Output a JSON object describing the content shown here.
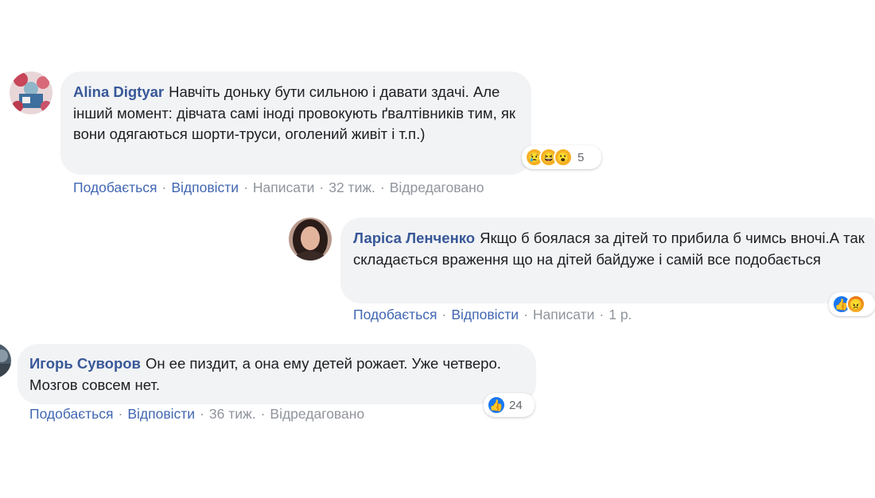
{
  "comments": [
    {
      "author": "Alina Digtyar",
      "text": "Навчіть доньку бути сильною і давати здачі. Але інший момент: дівчата самі іноді провокують ґвалтівників тим, як вони одягаються шорти-труси, оголений живіт і т.п.)",
      "reaction_count": "5",
      "reaction_icons": [
        "sad-icon",
        "haha-icon",
        "wow-icon"
      ],
      "actions": {
        "like": "Подобається",
        "reply": "Відповісти",
        "message": "Написати",
        "time": "32 тиж.",
        "edited": "Відредаговано"
      }
    },
    {
      "author": "Ларіса Ленченко",
      "text": "Якщо б боялася за дітей то прибила б чимсь вночі.А так складається враження що на дітей байдуже і самій все подобається",
      "reaction_icons": [
        "like-icon",
        "angry-icon"
      ],
      "actions": {
        "like": "Подобається",
        "reply": "Відповісти",
        "message": "Написати",
        "time": "1 р."
      }
    },
    {
      "author": "Игорь Суворов",
      "text": "Он ее пиздит, а она ему детей рожает. Уже четверо. Мозгов совсем нет.",
      "reaction_count": "24",
      "reaction_icons": [
        "like-icon"
      ],
      "actions": {
        "like": "Подобається",
        "reply": "Відповісти",
        "time": "36 тиж.",
        "edited": "Відредаговано"
      }
    }
  ],
  "colors": {
    "author": "#385898",
    "link": "#4267b2",
    "meta": "#90949c",
    "bubble": "#f2f3f5",
    "like": "#1877f2",
    "emoji": "#f7b125"
  }
}
